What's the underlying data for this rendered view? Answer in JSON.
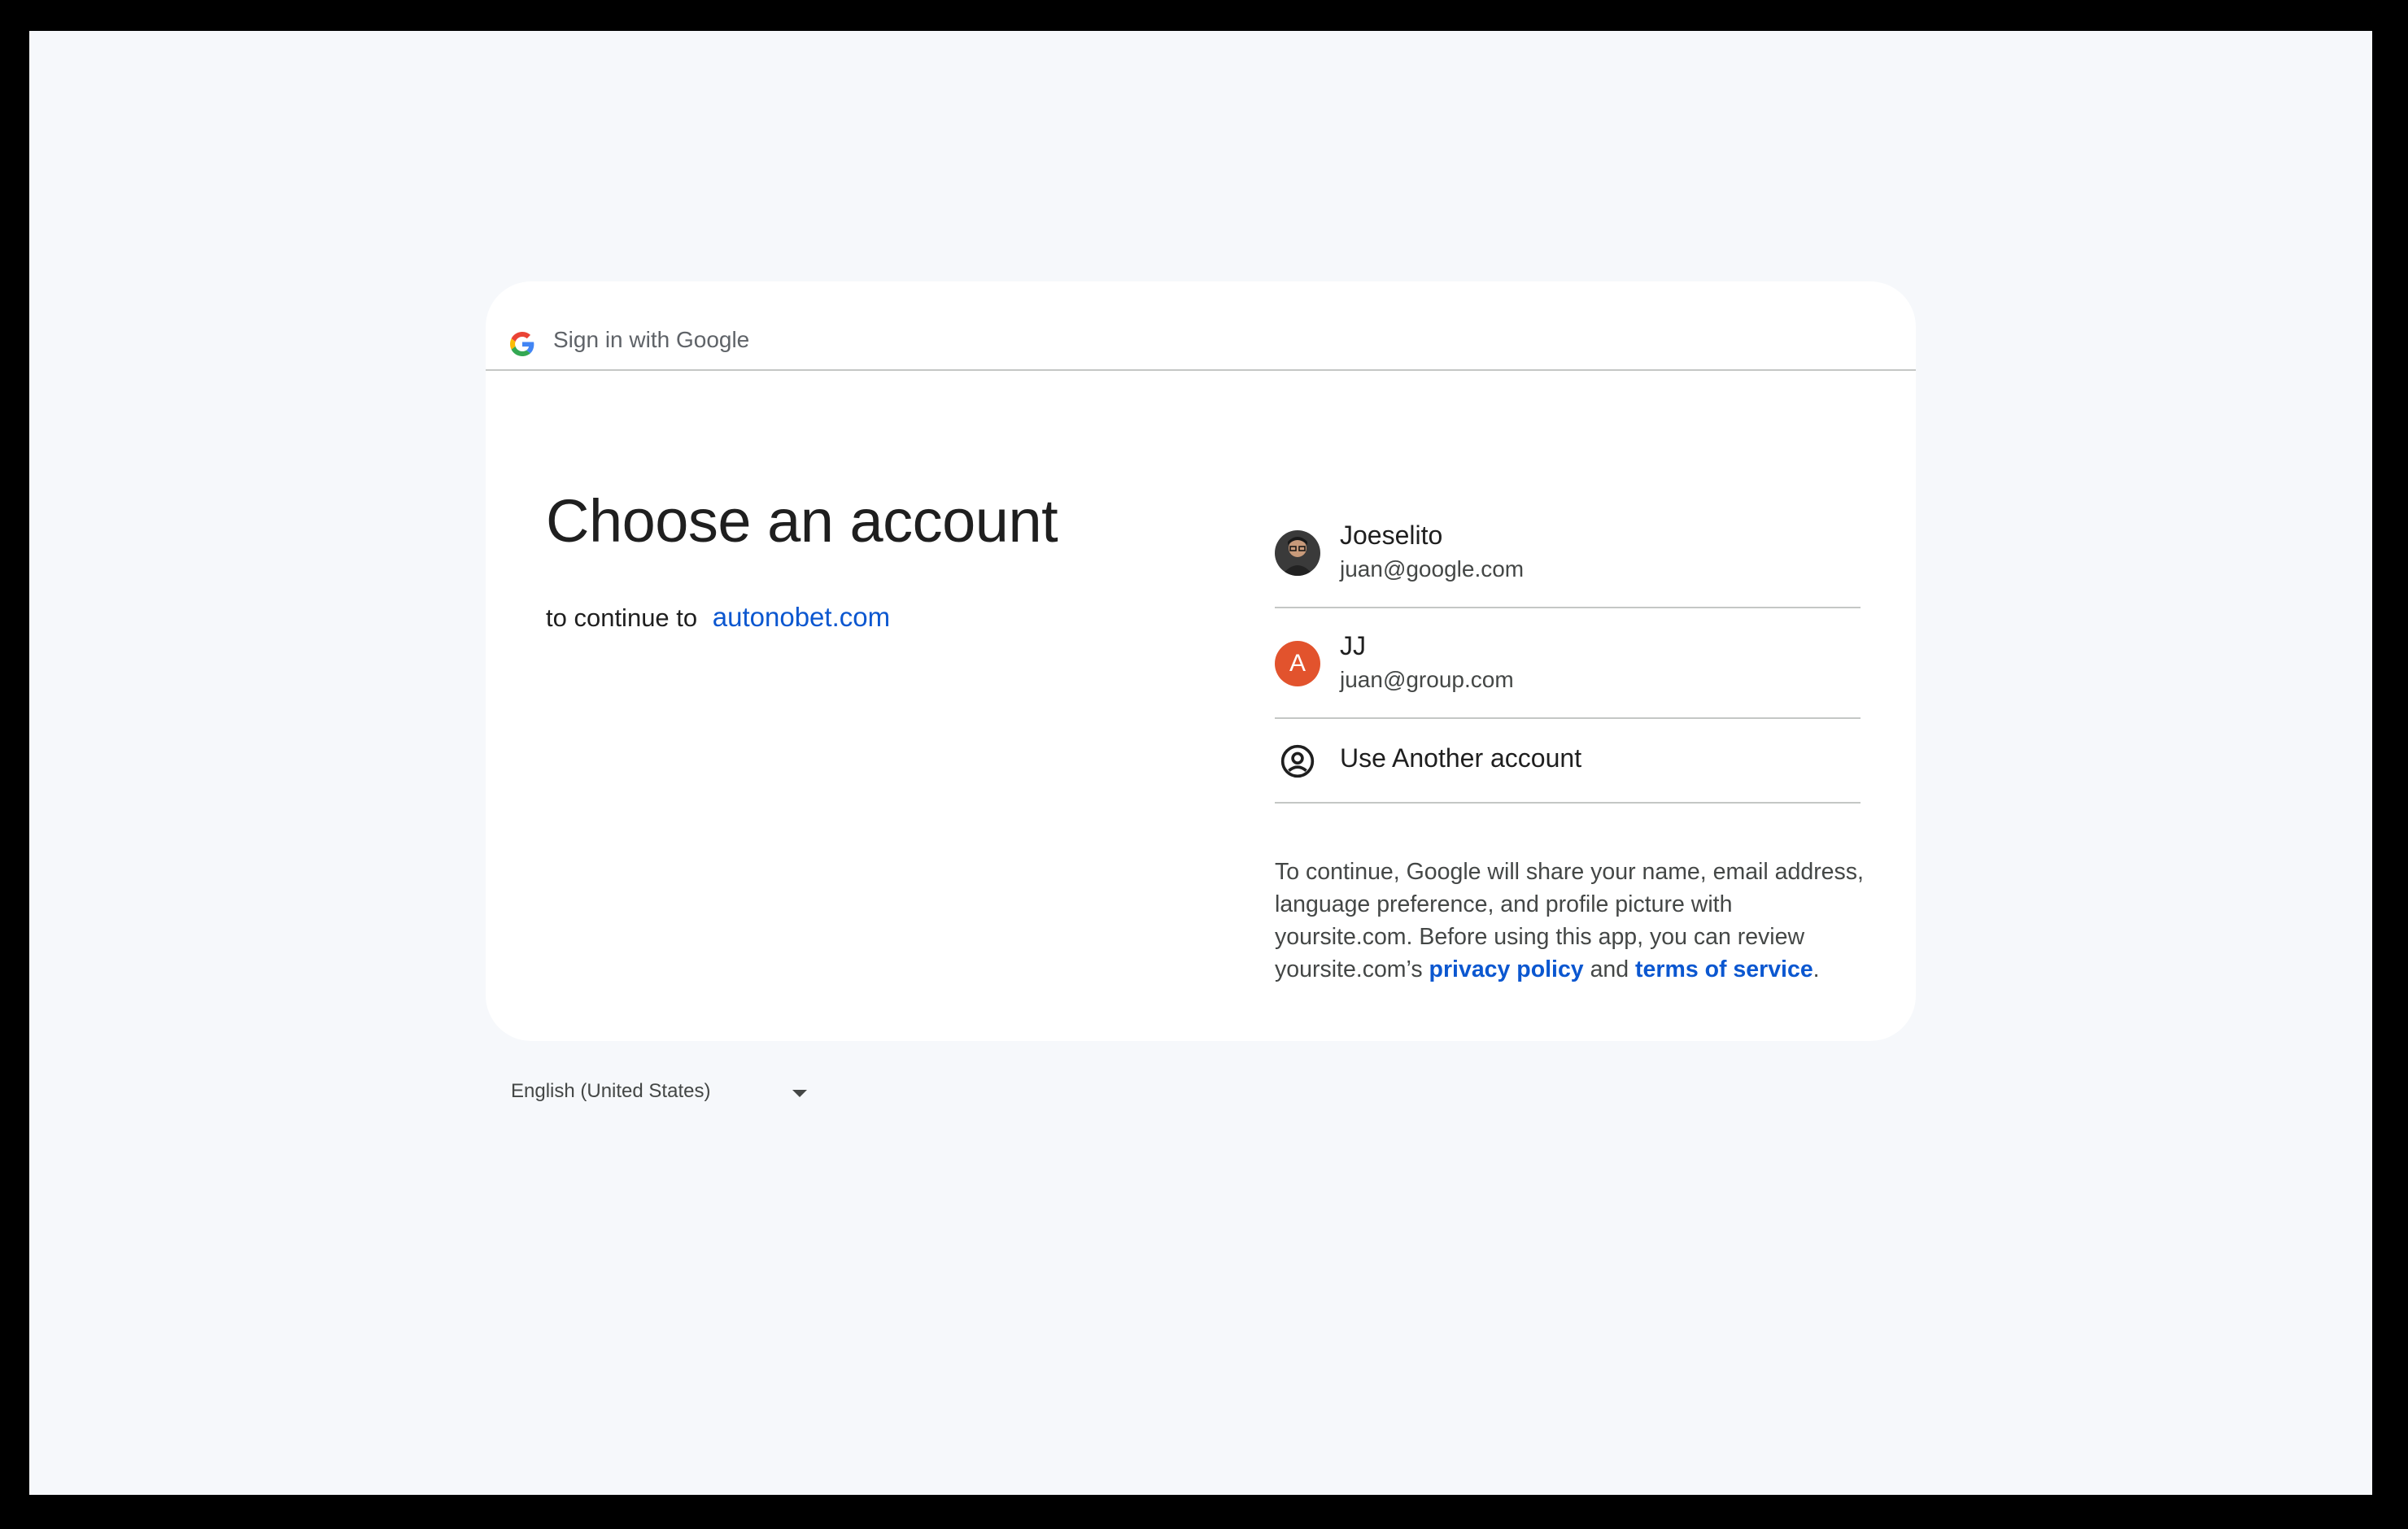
{
  "header": {
    "title": "Sign in with Google",
    "logo_icon": "google-g-icon"
  },
  "main": {
    "headline": "Choose an account",
    "continue_prefix": "to continue to",
    "continue_site": "autonobet.com"
  },
  "accounts": [
    {
      "name": "Joeselito",
      "email": "juan@google.com",
      "avatar": "photo"
    },
    {
      "name": "JJ",
      "email": "juan@group.com",
      "avatar": "A",
      "avatar_color": "#e2532d"
    }
  ],
  "another_account": {
    "label": "Use Another account",
    "icon": "account-circle-icon"
  },
  "disclaimer": {
    "text_1": "To continue, Google will share your name, email address, language preference, and profile picture with yoursite.com. Before using this app, you can review yoursite.com’s",
    "privacy_link": "privacy policy",
    "and_text": "and",
    "terms_link": "terms of service",
    "end_text": "."
  },
  "footer": {
    "language": "English (United States)"
  },
  "colors": {
    "link": "#0b57d0",
    "background": "#f6f8fb",
    "card": "#ffffff",
    "divider": "#c4c7c5"
  }
}
